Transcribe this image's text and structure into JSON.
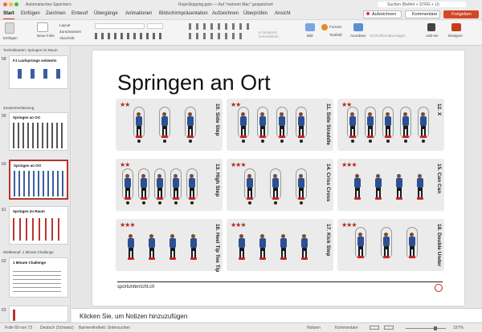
{
  "titlebar": {
    "autosave": "Automatisches Speichern",
    "doc_title": "RopeSkipping.pptx — Auf \"meinem Mac\" gespeichert",
    "search": "Suchen (Befehl + STRG + U)"
  },
  "ribbon_tabs": [
    "Start",
    "Einfügen",
    "Zeichnen",
    "Entwurf",
    "Übergänge",
    "Animationen",
    "Bildschirmpräsentation",
    "Aufzeichnen",
    "Überprüfen",
    "Ansicht"
  ],
  "ribbon_buttons": {
    "record": "Aufzeichnen",
    "comments": "Kommentare",
    "share": "Freigeben"
  },
  "ribbon": {
    "paste": "Einfügen",
    "new_slide": "Neue Folie",
    "layout": "Layout",
    "reset": "Zurücksetzen",
    "section": "Abschnitt",
    "smartart": "In SmartArt konvertieren",
    "picture": "Bild",
    "shapes": "Formen",
    "textbox": "Textfeld",
    "arrange": "Anordnen",
    "quickstyles": "Schnellformatvorlagen",
    "addins": "Add-Ins",
    "designer": "Designer"
  },
  "sidebar": {
    "sections": [
      {
        "label": "Technikkarten: Springen im Raum"
      },
      {
        "label": "Zusammenfassung"
      },
      {
        "label": "Wettkampf: 1 Minute Challenge"
      }
    ],
    "slides": [
      {
        "num": "58",
        "title": "FJ Laufsprünge seitwärts"
      },
      {
        "num": "59",
        "title": "Springen an Ort"
      },
      {
        "num": "60",
        "title": "Springen an Ort"
      },
      {
        "num": "61",
        "title": "Springen im Raum"
      },
      {
        "num": "62",
        "title": "1 Minute Challenge"
      },
      {
        "num": "63",
        "title": ""
      }
    ]
  },
  "slide": {
    "title": "Springen an Ort",
    "footer": "sportunterricht.ch",
    "cards": [
      {
        "stars": "★★",
        "label": "10. Side Step"
      },
      {
        "stars": "★★",
        "label": "11. Side Straddle"
      },
      {
        "stars": "★★",
        "label": "12. X"
      },
      {
        "stars": "★★",
        "label": "13. High Step"
      },
      {
        "stars": "★★★",
        "label": "14. Criss Cross"
      },
      {
        "stars": "★★★",
        "label": "15. Can Can"
      },
      {
        "stars": "★★★",
        "label": "16. Heel Tip Toe Tip"
      },
      {
        "stars": "★★★",
        "label": "17. Kick Step"
      },
      {
        "stars": "★★★",
        "label": "18. Double Under"
      }
    ]
  },
  "notes": {
    "placeholder": "Klicken Sie, um Notizen hinzuzufügen"
  },
  "statusbar": {
    "slide_info": "Folie 60 von 73",
    "language": "Deutsch (Schweiz)",
    "accessibility": "Barrierefreiheit: Untersuchen",
    "notes": "Notizen",
    "comments": "Kommentare",
    "zoom": "157%"
  },
  "colors": {
    "accent": "#c43e1c",
    "figure_shirt": "#2d4f93",
    "stars": "#b3261e"
  }
}
